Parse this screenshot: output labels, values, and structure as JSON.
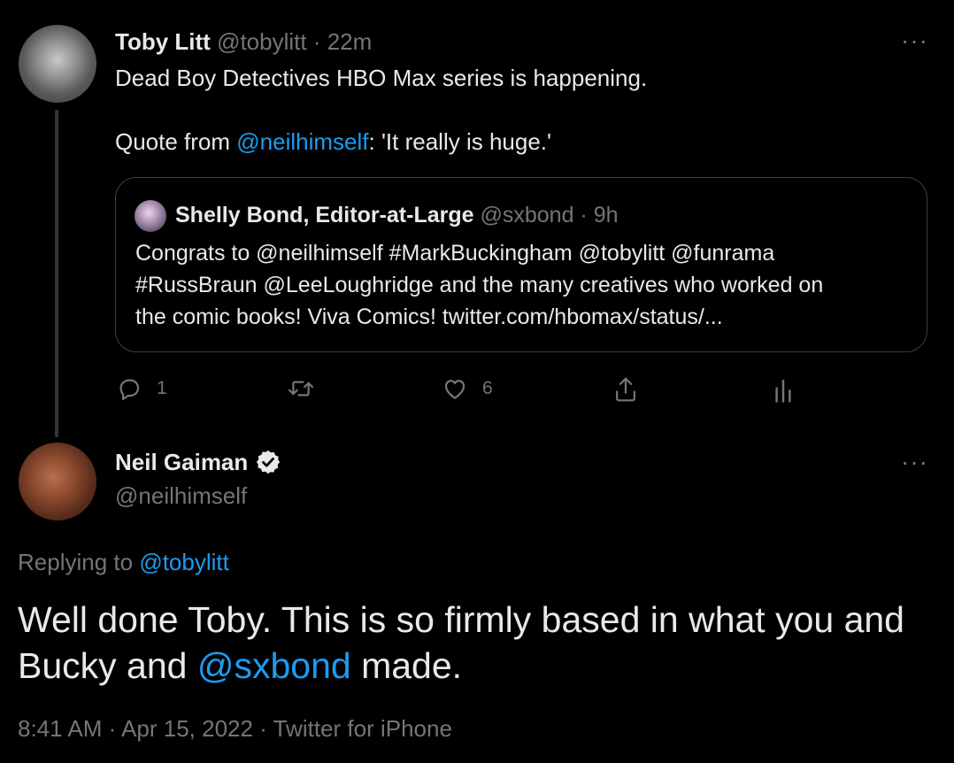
{
  "tweet1": {
    "author_name": "Toby Litt",
    "author_handle": "@tobylitt",
    "separator": " · ",
    "time": "22m",
    "more": "···",
    "line1": "Dead Boy Detectives HBO Max series is happening.",
    "line2_prefix": "Quote from ",
    "line2_mention": "@neilhimself",
    "line2_suffix": ": 'It really is huge.'",
    "quote": {
      "author_name": "Shelly Bond, Editor-at-Large",
      "author_handle": "@sxbond",
      "separator": " · ",
      "time": "9h",
      "line1": "Congrats to @neilhimself #MarkBuckingham @tobylitt @funrama",
      "line2": "#RussBraun @LeeLoughridge and the many creatives who worked on",
      "line3": "the comic books! Viva Comics! twitter.com/hbomax/status/..."
    },
    "actions": {
      "reply_count": "1",
      "like_count": "6"
    }
  },
  "tweet2": {
    "author_name": "Neil Gaiman",
    "author_handle": "@neilhimself",
    "more": "···",
    "replying_prefix": "Replying to ",
    "replying_mention": "@tobylitt",
    "text_part1": "Well done Toby. This is so firmly based in what you and",
    "text_part2": "Bucky and ",
    "text_mention": "@sxbond",
    "text_part3": " made.",
    "meta": "8:41 AM · Apr 15, 2022 · Twitter for iPhone"
  },
  "colors": {
    "background": "#000000",
    "text": "#e7e9ea",
    "muted": "#71767b",
    "link": "#1d9bf0",
    "border": "#3b3f44"
  },
  "icons": [
    "reply-icon",
    "retweet-icon",
    "like-icon",
    "share-icon",
    "analytics-icon",
    "verified-badge-icon",
    "more-icon"
  ]
}
